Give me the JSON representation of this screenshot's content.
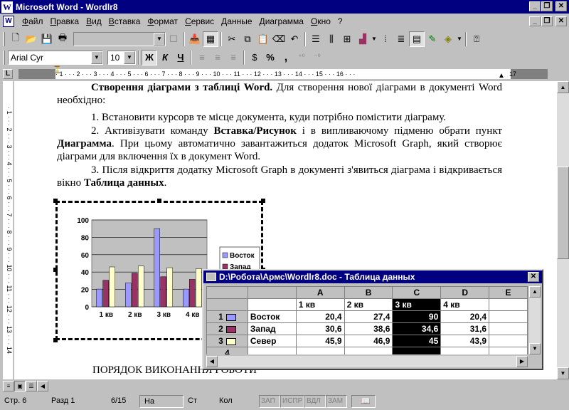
{
  "window": {
    "title": "Microsoft Word - Wordlr8"
  },
  "menu": [
    "Файл",
    "Правка",
    "Вид",
    "Вставка",
    "Формат",
    "Сервис",
    "Данные",
    "Диаграмма",
    "Окно",
    "?"
  ],
  "format_toolbar": {
    "font": "Arial Cyr",
    "size": "10",
    "bold": "Ж",
    "italic": "К",
    "underline": "Ч",
    "percent": "%",
    "comma": ","
  },
  "ruler_text": "· 1 · · · 2 · · · 3 · · · 4 · · · 5 · · · 6 · · · 7 · · · 8 · · · 9 · · · 10 · · · 11 · · · 12 · · · 13 · · · 14 · · · 15 · · · 16 · · ·",
  "ruler_right": "17",
  "vruler_text": "· 1 · · · 2 · · · 3 · · · 4 · · · 5 · · · 6 · · · 7 · · · 8 · · · 9 · · · 10 · · · 11 · · · 12 · · · 13 · · · 14",
  "document": {
    "p1_bold": "Створення діаграми з таблиці  Word.",
    "p1_rest": " Для створення нової діаграми в документі Word необхідно:",
    "p2": "1.   Встановити курсорв те місце документа, куди потрібно помістити діаграму.",
    "p3_a": "2.   Активізувати команду ",
    "p3_b": "Вставка/Рисунок",
    "p3_c": " і в випливаючому підменю обрати пункт ",
    "p3_d": "Диаграмма",
    "p3_e": ". При цьому автоматично завантажиться  додаток Microsoft Graph, який створює діаграми для включення їх в документ Word.",
    "p4_a": "3.   Після відкриття додатку Microsoft Graph в документі з'явиться діаграма і відкривається вікно ",
    "p4_b": "Таблица данных",
    "p4_c": ".",
    "heading2": "ПОРЯДОК ВИКОНАННЯ РОБОТИ"
  },
  "chart_data": {
    "type": "bar",
    "categories": [
      "1 кв",
      "2 кв",
      "3 кв",
      "4 кв"
    ],
    "series": [
      {
        "name": "Восток",
        "values": [
          20.4,
          27.4,
          90,
          20.4
        ],
        "color": "#9999ff"
      },
      {
        "name": "Запад",
        "values": [
          30.6,
          38.6,
          34.6,
          31.6
        ],
        "color": "#993366"
      },
      {
        "name": "Север",
        "values": [
          45.9,
          46.9,
          45,
          43.9
        ],
        "color": "#ffffcc"
      }
    ],
    "yticks": [
      "0",
      "20",
      "40",
      "60",
      "80",
      "100"
    ],
    "ylim": [
      0,
      100
    ],
    "grid": true,
    "legend": "right"
  },
  "datasheet": {
    "title": "D:\\Робота\\Армс\\Wordlr8.doc - Таблица данных",
    "columns": [
      "A",
      "B",
      "C",
      "D",
      "E"
    ],
    "rows": [
      {
        "num": "1",
        "name": "Восток",
        "cells": [
          "20,4",
          "27,4",
          "90",
          "20,4",
          ""
        ]
      },
      {
        "num": "2",
        "name": "Запад",
        "cells": [
          "30,6",
          "38,6",
          "34,6",
          "31,6",
          ""
        ]
      },
      {
        "num": "3",
        "name": "Север",
        "cells": [
          "45,9",
          "46,9",
          "45",
          "43,9",
          ""
        ]
      },
      {
        "num": "4",
        "name": "",
        "cells": [
          "",
          "",
          "",
          "",
          ""
        ]
      }
    ],
    "header_row": [
      "1 кв",
      "2 кв",
      "3 кв",
      "4 кв",
      ""
    ]
  },
  "status": {
    "page": "Стр. 6",
    "section": "Разд 1",
    "pages": "6/15",
    "at": "На",
    "line": "Ст",
    "col": "Кол",
    "rec": "ЗАП",
    "trk": "ИСПР",
    "ext": "ВДЛ",
    "ovr": "ЗАМ"
  }
}
